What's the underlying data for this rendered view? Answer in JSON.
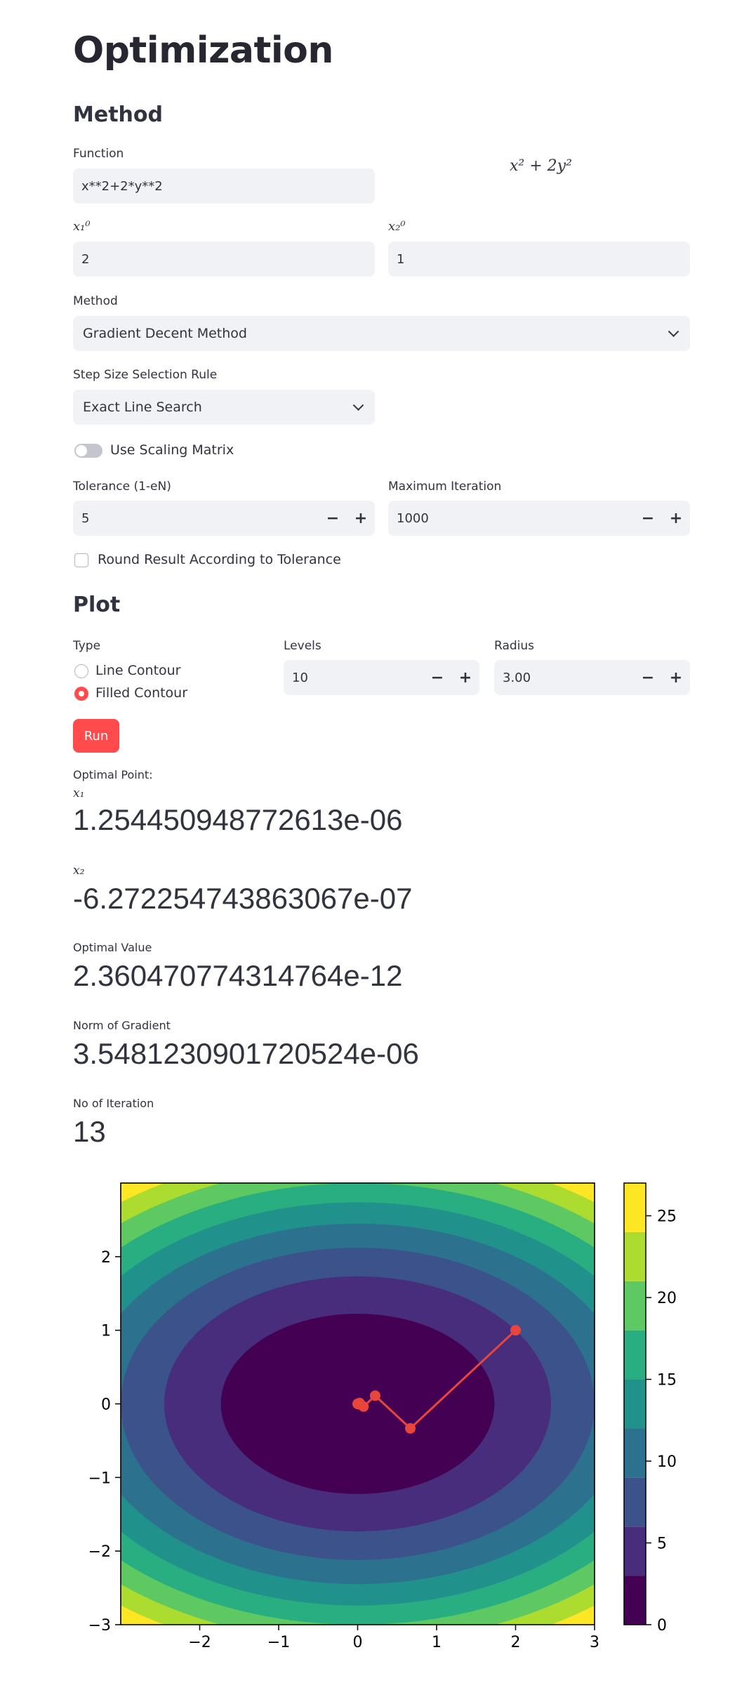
{
  "page_title": "Optimization",
  "method_section": {
    "heading": "Method",
    "function_label": "Function",
    "function_value": "x**2+2*y**2",
    "function_latex": "x² + 2y²",
    "x1_label": "x₁⁰",
    "x1_value": "2",
    "x2_label": "x₂⁰",
    "x2_value": "1",
    "method_label": "Method",
    "method_value": "Gradient Decent Method",
    "step_rule_label": "Step Size Selection Rule",
    "step_rule_value": "Exact Line Search",
    "scaling_label": "Use Scaling Matrix",
    "tolerance_label": "Tolerance (1-eN)",
    "tolerance_value": "5",
    "max_iter_label": "Maximum Iteration",
    "max_iter_value": "1000",
    "round_label": "Round Result According to Tolerance"
  },
  "plot_section": {
    "heading": "Plot",
    "type_label": "Type",
    "type_options": [
      "Line Contour",
      "Filled Contour"
    ],
    "type_selected": "Filled Contour",
    "levels_label": "Levels",
    "levels_value": "10",
    "radius_label": "Radius",
    "radius_value": "3.00",
    "minus_symbol": "−",
    "plus_symbol": "+"
  },
  "run_button": "Run",
  "results": {
    "optimal_point_label": "Optimal Point:",
    "x1_label": "x₁",
    "x1_value": "1.254450948772613e-06",
    "x2_label": "x₂",
    "x2_value": "-6.272254743863067e-07",
    "optimal_value_label": "Optimal Value",
    "optimal_value": "2.360470774314764e-12",
    "grad_norm_label": "Norm of Gradient",
    "grad_norm_value": "3.5481230901720524e-06",
    "iterations_label": "No of Iteration",
    "iterations_value": "13"
  },
  "colors": {
    "accent": "#ff4b4b",
    "input_bg": "#f0f2f6",
    "path": "#e8453c"
  },
  "chart_data": {
    "type": "contour",
    "function": "x^2 + 2y^2",
    "xlim": [
      -3,
      3
    ],
    "ylim": [
      -3,
      3
    ],
    "x_ticks": [
      -2,
      -1,
      0,
      1,
      2,
      3
    ],
    "y_ticks": [
      -3,
      -2,
      -1,
      0,
      1,
      2
    ],
    "x_tick_labels": [
      "−2",
      "−1",
      "0",
      "1",
      "2",
      "3"
    ],
    "y_tick_labels": [
      "−3",
      "−2",
      "−1",
      "0",
      "1",
      "2"
    ],
    "levels": [
      0,
      3,
      6,
      9,
      12,
      15,
      18,
      21,
      24,
      27
    ],
    "level_colors": [
      "#440154",
      "#472d7b",
      "#3b528b",
      "#2c728e",
      "#21918c",
      "#28ae80",
      "#5ec962",
      "#addc30",
      "#fde725"
    ],
    "colorbar_ticks": [
      0,
      5,
      10,
      15,
      20,
      25
    ],
    "colorbar_tick_labels": [
      "0",
      "5",
      "10",
      "15",
      "20",
      "25"
    ],
    "path": [
      {
        "x": 2.0,
        "y": 1.0
      },
      {
        "x": 0.667,
        "y": -0.333
      },
      {
        "x": 0.222,
        "y": 0.111
      },
      {
        "x": 0.074,
        "y": -0.037
      },
      {
        "x": 0.025,
        "y": 0.012
      },
      {
        "x": 0.008,
        "y": -0.004
      },
      {
        "x": 0.003,
        "y": 0.001
      },
      {
        "x": 0.0,
        "y": 0.0
      }
    ]
  }
}
